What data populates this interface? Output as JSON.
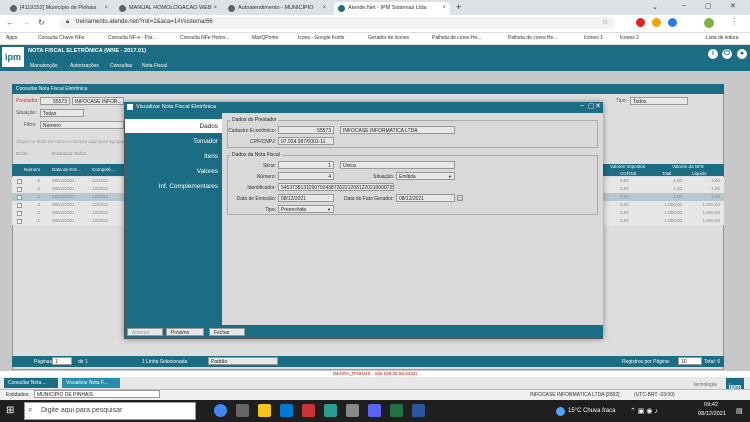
{
  "browser": {
    "tabs": [
      {
        "label": "[4119152] Município de Pinhais"
      },
      {
        "label": "MANUAL HOMOLOGACAO WEB"
      },
      {
        "label": "Autoatendimento - MUNICÍPIO"
      },
      {
        "label": "Atende.Net - IPM Sistemas Ltda"
      }
    ],
    "url": "treinamento.atende.net/?rot=1&aca=1#!/sistema/66",
    "bookmarks": [
      "Apps",
      "Consulta Chave NFe",
      "Consulta NF-e - Par...",
      "Consulta NFe Homo...",
      "MaxQPonto",
      "Icons - Google Fonts",
      "Gerador de icones",
      "Palheta de cores He...",
      "Palheta de cores He...",
      "Icones 1",
      "Icones 2"
    ],
    "reading_list": "Lista de leitura"
  },
  "app": {
    "logo": "ipm",
    "title": "NOTA FISCAL ELETRÔNICA (WNE - 2017.01)",
    "menu": [
      "Manutenção",
      "Autorizações",
      "Consultas",
      "Nota Fiscal"
    ]
  },
  "background": {
    "panel_title": "Consultar Nota Fiscal Eletrônica",
    "prestador_label": "Prestador:",
    "prestador_code": "55573",
    "prestador_name": "INFOCASE INFOR...",
    "tipo_label": "Tipo:",
    "tipo_value": "Todos",
    "situacao_label": "Situação:",
    "situacao_value": "Todas",
    "filtro_label": "Filtro:",
    "filtro_value": "Número",
    "drag_hint": "Clique no título da coluna e arraste aqui para agrupar",
    "toolbar": [
      "Emitir",
      "Download Todos"
    ],
    "col_numero": "Número",
    "col_data": "Data de Emi...",
    "col_comp": "Competê...",
    "col_impostos": "Valores Impostos",
    "col_nfe": "Valores da NFE",
    "col_cofins": "COFINS",
    "col_total": "Total",
    "col_liquido": "Líquido",
    "rows": [
      {
        "n": "6",
        "d": "08/12/2021",
        "c": "12/2021",
        "cof": "0,00",
        "t": "1,00",
        "l": "1,00"
      },
      {
        "n": "5",
        "d": "08/12/2021",
        "c": "12/2021",
        "cof": "0,00",
        "t": "1,00",
        "l": "1,00"
      },
      {
        "n": "4",
        "d": "08/12/2021",
        "c": "12/2021",
        "cof": "0,00",
        "t": "1,00",
        "l": "1,00"
      },
      {
        "n": "3",
        "d": "08/12/2021",
        "c": "12/2021",
        "cof": "0,00",
        "t": "1.000,00",
        "l": "1.000,00"
      },
      {
        "n": "2",
        "d": "08/12/2021",
        "c": "12/2021",
        "cof": "0,00",
        "t": "1.000,00",
        "l": "1.000,00"
      },
      {
        "n": "1",
        "d": "08/12/2021",
        "c": "12/2021",
        "cof": "0,00",
        "t": "1.000,00",
        "l": "1.000,00"
      }
    ]
  },
  "modal": {
    "title": "Visualizar Nota Fiscal Eletrônica",
    "nav": [
      "Dados",
      "Tomador",
      "Itens",
      "Valores",
      "Inf. Complementares"
    ],
    "section_prestador": "Dados do Prestador",
    "cadastro_label": "Cadastro Econômico:",
    "cadastro_value": "55573",
    "empresa_value": "INFOCASE INFORMATICA LTDA",
    "cpf_label": "CPF/CNPJ:",
    "cpf_value": "07.924.387/0001-11",
    "section_nota": "Dados da Nota Fiscal",
    "serie_label": "Série:",
    "serie_value": "1",
    "serie_desc": "Única",
    "numero_label": "Número:",
    "numero_value": "4",
    "situacao_label": "Situação:",
    "situacao_value": "Emitida",
    "ident_label": "Identificador:",
    "ident_value": "54537381312007924387202212081220210000729",
    "emissao_label": "Data de Emissão:",
    "emissao_value": "08/12/2021",
    "fatogerador_label": "Data do Fato Gerador:",
    "fatogerador_value": "08/12/2021",
    "tipo_label": "Tipo:",
    "tipo_value": "Preenchido",
    "btn_anterior": "Anterior",
    "btn_proximo": "Próximo",
    "btn_fechar": "Fechar"
  },
  "pager": {
    "paginas_label": "Páginas",
    "page": "1",
    "of_label": "de 1",
    "selected": "1 Linha Selecionada",
    "padrao": "Padrão",
    "rows_label": "Registros por Página:",
    "rows_value": "10",
    "total": "Total: 6"
  },
  "status_line": "(MIGRA_PINHAIS - 192.168.25.55:5432)",
  "app_tabs": [
    "Consultar Nota ...",
    "Visualizar Nota F..."
  ],
  "brand": "tecnologia",
  "entidades_label": "Entidades:",
  "entidades_value": "MUNICÍPIO DE PINHAIS",
  "user_info": "INFOCASE INFORMATICA LTDA [2892]",
  "timezone": "(UTC-BRT -03:00)",
  "taskbar": {
    "search_placeholder": "Digite aqui para pesquisar",
    "weather": "15°C  Chuva fraca",
    "time": "09:42",
    "date": "08/12/2021"
  }
}
